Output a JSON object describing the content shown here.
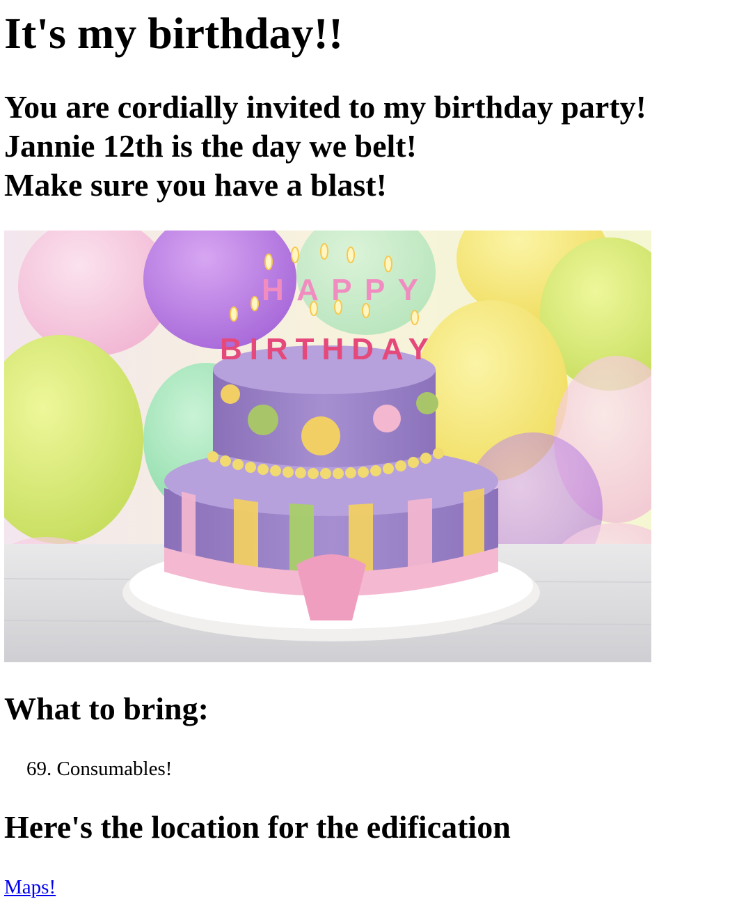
{
  "title": "It's my birthday!!",
  "invite": {
    "line1": "You are cordially invited to my birthday party!",
    "line2": "Jannie 12th is the day we belt!",
    "line3": "Make sure you have a blast!"
  },
  "cake_image": {
    "candle_letters_top": "HAPPY",
    "candle_letters_bottom": "BIRTHDAY"
  },
  "bring": {
    "heading": "What to bring:",
    "items": [
      {
        "number": "69.",
        "text": "Consumables!"
      }
    ]
  },
  "location": {
    "heading": "Here's the location for the edification",
    "link_label": "Maps!"
  },
  "colors": {
    "link": "#0000ee",
    "text": "#000000",
    "background": "#ffffff"
  }
}
